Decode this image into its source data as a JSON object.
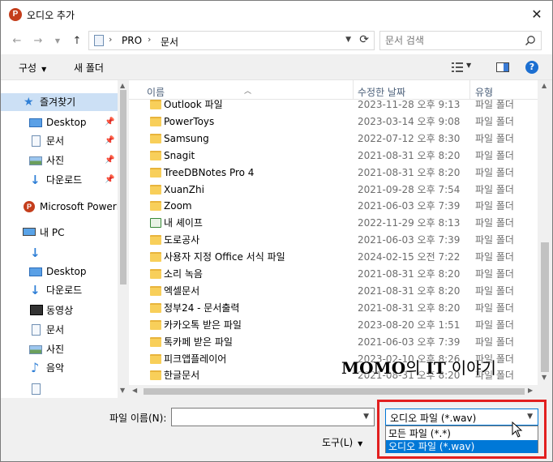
{
  "window": {
    "title": "오디오 추가",
    "app_icon": "powerpoint-icon",
    "close_glyph": "✕"
  },
  "address_bar": {
    "segments": [
      "PRO",
      "문서"
    ],
    "separator": "›"
  },
  "search": {
    "placeholder": "문서 검색"
  },
  "toolbar": {
    "organize_label": "구성",
    "new_folder_label": "새 폴더",
    "help_label": "?"
  },
  "nav_pane": {
    "items": [
      {
        "label": "즐겨찾기",
        "icon": "star-icon"
      },
      {
        "label": "Desktop",
        "icon": "desktop-icon",
        "pinned": true
      },
      {
        "label": "문서",
        "icon": "document-icon",
        "pinned": true
      },
      {
        "label": "사진",
        "icon": "picture-icon",
        "pinned": true
      },
      {
        "label": "다운로드",
        "icon": "download-icon",
        "pinned": true
      },
      {
        "label": "Microsoft PowerP",
        "icon": "powerpoint-icon"
      },
      {
        "label": "내 PC",
        "icon": "pc-icon"
      },
      {
        "label": "",
        "icon": "download-icon"
      },
      {
        "label": "Desktop",
        "icon": "desktop-icon"
      },
      {
        "label": "다운로드",
        "icon": "download-icon"
      },
      {
        "label": "동영상",
        "icon": "video-icon"
      },
      {
        "label": "문서",
        "icon": "document-icon"
      },
      {
        "label": "사진",
        "icon": "picture-icon"
      },
      {
        "label": "음악",
        "icon": "music-icon"
      },
      {
        "label": "",
        "icon": "document-icon"
      }
    ]
  },
  "file_list": {
    "columns": {
      "name": "이름",
      "date": "수정한 날짜",
      "type": "유형"
    },
    "rows": [
      {
        "name": "Outlook 파일",
        "date": "2023-11-28 오후 9:13",
        "type": "파일 폴더"
      },
      {
        "name": "PowerToys",
        "date": "2023-03-14 오후 9:08",
        "type": "파일 폴더"
      },
      {
        "name": "Samsung",
        "date": "2022-07-12 오후 8:30",
        "type": "파일 폴더"
      },
      {
        "name": "Snagit",
        "date": "2021-08-31 오후 8:20",
        "type": "파일 폴더"
      },
      {
        "name": "TreeDBNotes Pro 4",
        "date": "2021-08-31 오후 8:20",
        "type": "파일 폴더"
      },
      {
        "name": "XuanZhi",
        "date": "2021-09-28 오후 7:54",
        "type": "파일 폴더"
      },
      {
        "name": "Zoom",
        "date": "2021-06-03 오후 7:39",
        "type": "파일 폴더"
      },
      {
        "name": "내 셰이프",
        "date": "2022-11-29 오후 8:13",
        "type": "파일 폴더",
        "icon": "excel-folder-icon"
      },
      {
        "name": "도로공사",
        "date": "2021-06-03 오후 7:39",
        "type": "파일 폴더"
      },
      {
        "name": "사용자 지정 Office 서식 파일",
        "date": "2024-02-15 오전 7:22",
        "type": "파일 폴더"
      },
      {
        "name": "소리 녹음",
        "date": "2021-08-31 오후 8:20",
        "type": "파일 폴더"
      },
      {
        "name": "엑셀문서",
        "date": "2021-08-31 오후 8:20",
        "type": "파일 폴더"
      },
      {
        "name": "정부24 - 문서출력",
        "date": "2021-08-31 오후 8:20",
        "type": "파일 폴더"
      },
      {
        "name": "카카오톡 받은 파일",
        "date": "2023-08-20 오후 1:51",
        "type": "파일 폴더"
      },
      {
        "name": "톡카페 받은 파일",
        "date": "2021-06-03 오후 7:39",
        "type": "파일 폴더"
      },
      {
        "name": "피크앱플레이어",
        "date": "2023-02-10 오후 8:26",
        "type": "파일 폴더"
      },
      {
        "name": "한글문서",
        "date": "2021-08-31 오후 8:20",
        "type": "파일 폴더"
      }
    ]
  },
  "watermark": {
    "part1": "MOMO",
    "part2": "의",
    "part3": "IT",
    "part4": "이야기"
  },
  "bottom": {
    "file_name_label": "파일 이름(N):",
    "file_name_value": "",
    "file_type_selected": "오디오 파일 (*.wav)",
    "file_type_options": [
      "모든 파일 (*.*)",
      "오디오 파일 (*.wav)"
    ],
    "selected_option_index": 1,
    "tools_label": "도구(L)"
  },
  "colors": {
    "accent": "#0078d7",
    "highlight_border": "#e21f1f",
    "folder": "#f8cf5a",
    "nav_selected": "#cce0f5"
  }
}
